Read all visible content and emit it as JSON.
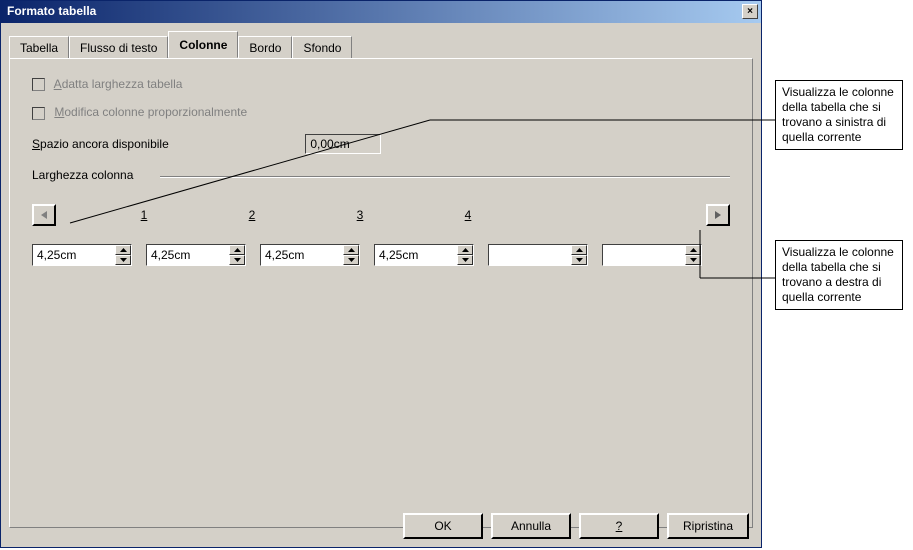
{
  "window": {
    "title": "Formato tabella",
    "close_glyph": "×"
  },
  "tabs": {
    "tabella": "Tabella",
    "flusso": "Flusso di testo",
    "colonne": "Colonne",
    "bordo": "Bordo",
    "sfondo": "Sfondo"
  },
  "checks": {
    "adatta_pre": "A",
    "adatta_post": "datta larghezza tabella",
    "modifica_pre": "M",
    "modifica_post": "odifica colonne proporzionalmente"
  },
  "labels": {
    "spazio_pre": "S",
    "spazio_post": "pazio ancora disponibile",
    "larghezza": "Larghezza colonna"
  },
  "values": {
    "spazio": "0,00cm"
  },
  "col_headers": {
    "c1": "1",
    "c2": "2",
    "c3": "3",
    "c4": "4"
  },
  "col_values": {
    "v1": "4,25cm",
    "v2": "4,25cm",
    "v3": "4,25cm",
    "v4": "4,25cm",
    "v5": "",
    "v6": ""
  },
  "buttons": {
    "ok": "OK",
    "annulla": "Annulla",
    "help": "?",
    "ripristina": "Ripristina"
  },
  "callouts": {
    "left": "Visualizza le colonne della tabella che si trovano a sinistra di quella corrente",
    "right": "Visualizza le colonne della tabella che si trovano a destra di quella corrente"
  }
}
